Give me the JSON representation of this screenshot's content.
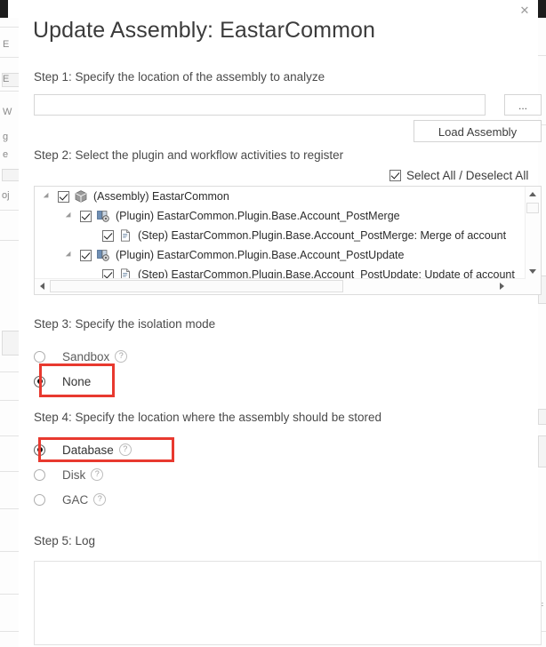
{
  "dialog": {
    "title": "Update Assembly: EastarCommon",
    "close_icon": "close-icon",
    "close_label": "✕"
  },
  "step1": {
    "label": "Step 1: Specify the location of the assembly to analyze",
    "path_value": "",
    "path_placeholder": "",
    "browse_label": "...",
    "load_label": "Load Assembly"
  },
  "step2": {
    "label": "Step 2: Select the plugin and workflow activities to register",
    "select_all_label": "Select All / Deselect All",
    "select_all_checked": true,
    "tree": [
      {
        "label": "(Assembly) EastarCommon",
        "icon": "assembly-icon",
        "checked": true,
        "expandable": true,
        "depth": 0
      },
      {
        "label": "(Plugin) EastarCommon.Plugin.Base.Account_PostMerge",
        "icon": "plugin-icon",
        "checked": true,
        "expandable": true,
        "depth": 1
      },
      {
        "label": "(Step) EastarCommon.Plugin.Base.Account_PostMerge: Merge of account",
        "icon": "step-icon",
        "checked": true,
        "expandable": false,
        "depth": 2
      },
      {
        "label": "(Plugin) EastarCommon.Plugin.Base.Account_PostUpdate",
        "icon": "plugin-icon",
        "checked": true,
        "expandable": true,
        "depth": 1
      },
      {
        "label": "(Step) EastarCommon.Plugin.Base.Account_PostUpdate: Update of account",
        "icon": "step-icon",
        "checked": true,
        "expandable": false,
        "depth": 2
      }
    ],
    "scroll_up_icon": "scroll-up-arrow-icon",
    "scroll_down_icon": "scroll-down-arrow-icon",
    "scroll_left_icon": "scroll-left-arrow-icon",
    "scroll_right_icon": "scroll-right-arrow-icon"
  },
  "step3": {
    "label": "Step 3: Specify the isolation mode",
    "options": [
      {
        "label": "Sandbox",
        "selected": false,
        "help": "?",
        "has_help": true,
        "dim": true
      },
      {
        "label": "None",
        "selected": true,
        "help": "",
        "has_help": false,
        "dim": false
      }
    ],
    "highlighted_option": "None"
  },
  "step4": {
    "label": "Step 4: Specify the location where the assembly should be stored",
    "options": [
      {
        "label": "Database",
        "selected": true,
        "help": "?",
        "has_help": true,
        "dim": false
      },
      {
        "label": "Disk",
        "selected": false,
        "help": "?",
        "has_help": true,
        "dim": true
      },
      {
        "label": "GAC",
        "selected": false,
        "help": "?",
        "has_help": true,
        "dim": true
      }
    ],
    "highlighted_option": "Database"
  },
  "step5": {
    "label": "Step 5: Log",
    "log_value": "",
    "log_placeholder": ""
  },
  "background": {
    "fragments": [
      "E",
      "E",
      "W",
      "g",
      "e",
      "oj"
    ]
  },
  "colors": {
    "highlight": "#e8392f",
    "text": "#333333",
    "muted": "#8a8a8a",
    "border": "#dcdcdc",
    "panel": "#ffffff"
  }
}
